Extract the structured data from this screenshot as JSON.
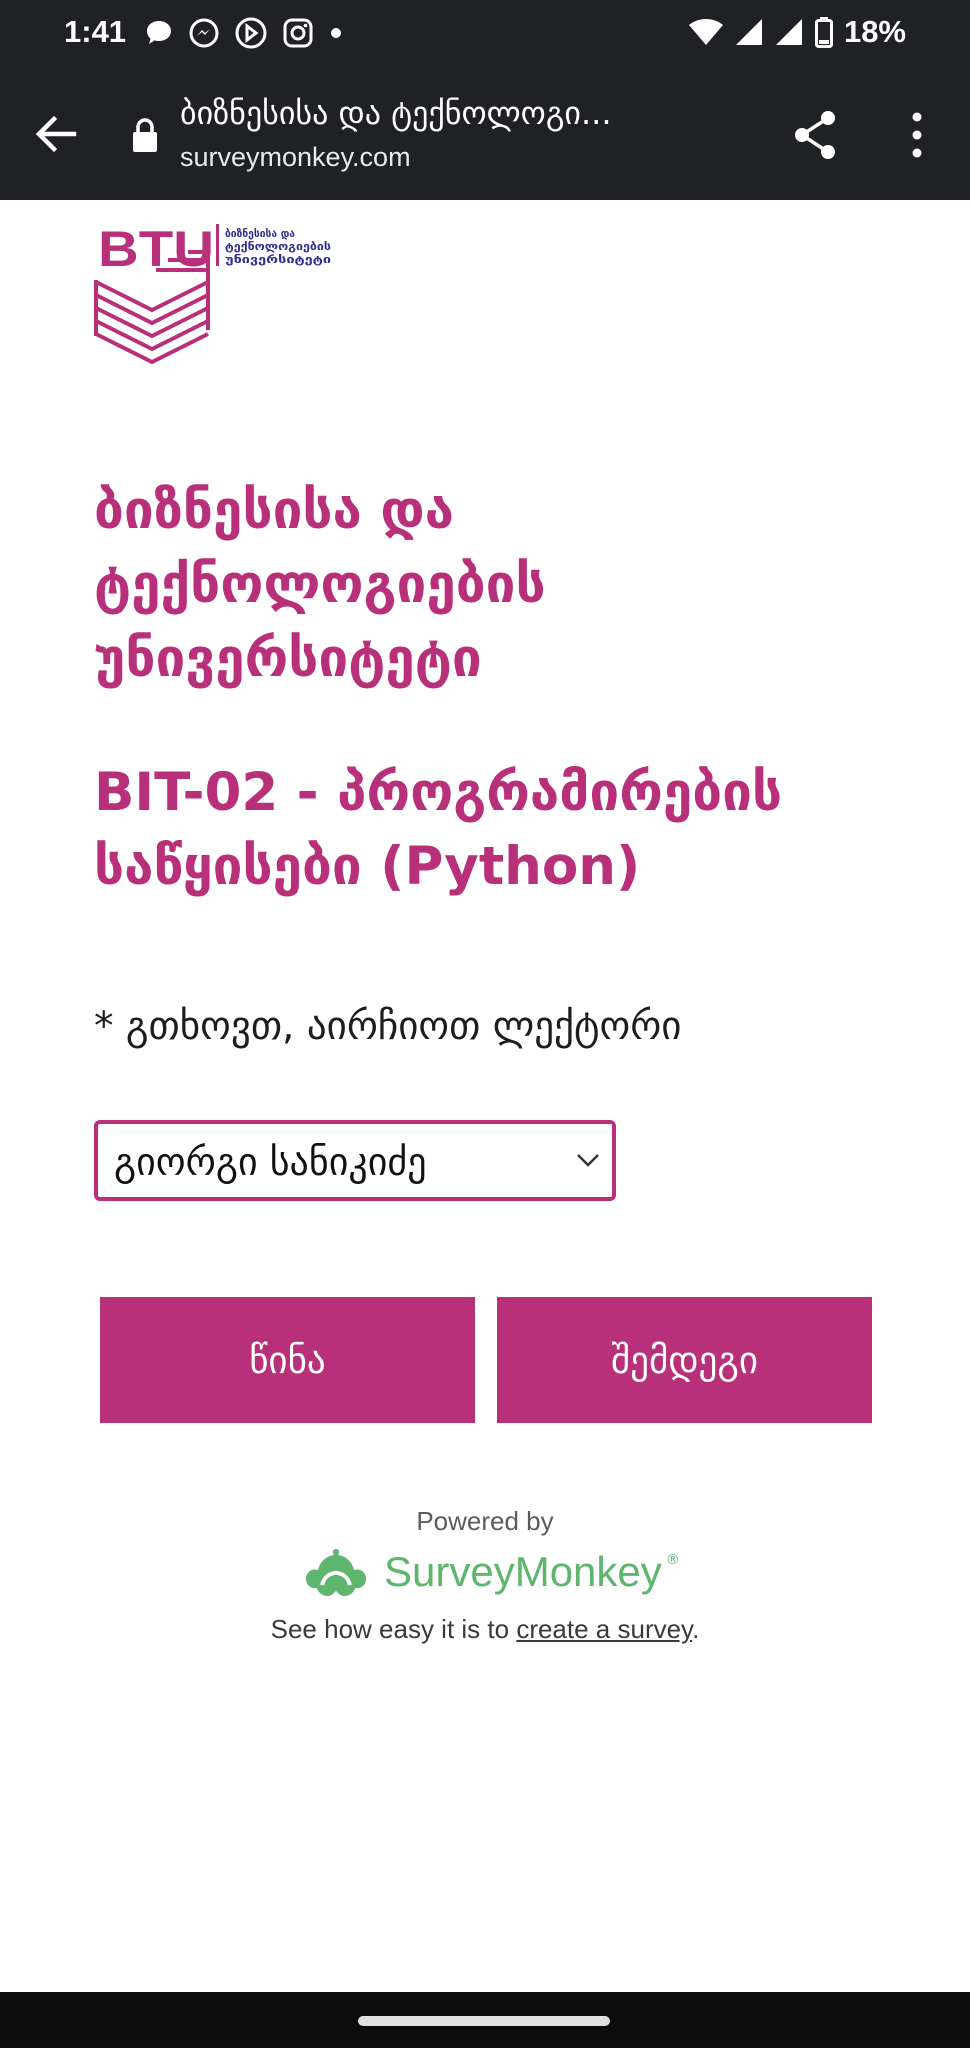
{
  "status_bar": {
    "time": "1:41",
    "battery": "18%",
    "left_icons": [
      "chat-bubble-icon",
      "messenger-icon",
      "phone-app-icon",
      "instagram-icon",
      "dot-icon"
    ],
    "right_icons": [
      "wifi-icon",
      "signal-icon",
      "signal-icon",
      "battery-icon"
    ]
  },
  "browser": {
    "title": "ბიზნესისა და ტექნოლოგი...",
    "url": "surveymonkey.com"
  },
  "page": {
    "logo_text": "BTU",
    "logo_tagline": [
      "ბიზნესისა და",
      "ტექნოლოგიების",
      "უნივერსიტეტი"
    ],
    "heading": "ბიზნესისა და ტექნოლოგიების უნივერსიტეტი",
    "subheading": "BIT-02 - პროგრამირების საწყისები (Python)",
    "question": "* გთხოვთ, აირჩიოთ ლექტორი",
    "selected_option": "გიორგი სანიკიძე",
    "prev_button": "წინა",
    "next_button": "შემდეგი"
  },
  "footer": {
    "powered_by": "Powered by",
    "brand": "SurveyMonkey",
    "brand_mark": "®",
    "prefix": "See how easy it is to ",
    "link": "create a survey",
    "suffix": "."
  },
  "colors": {
    "brand": "#b8307a",
    "surveymonkey_green": "#5eb56d",
    "chrome_dark": "#202124"
  }
}
